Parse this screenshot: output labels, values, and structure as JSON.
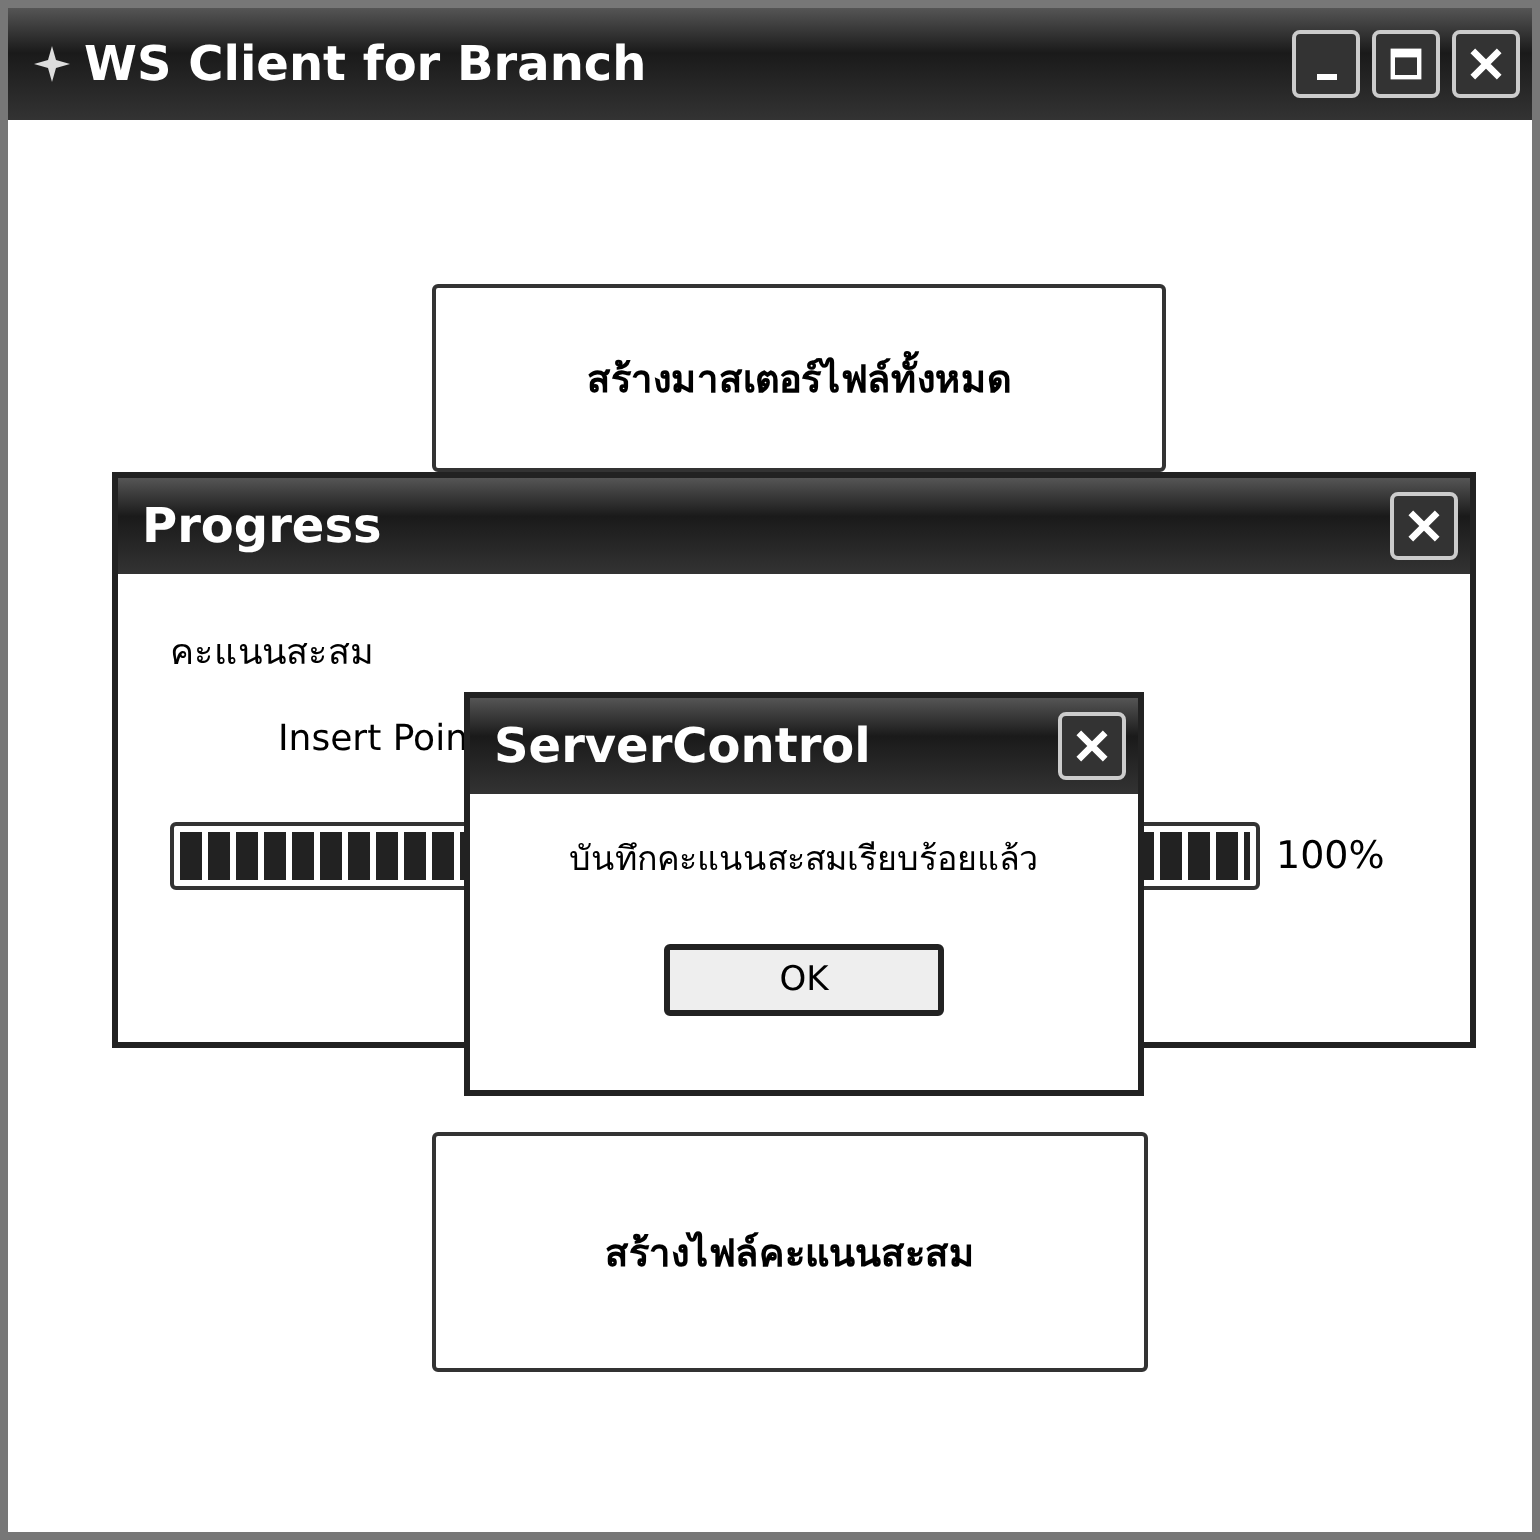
{
  "window": {
    "title": "WS Client for Branch"
  },
  "buttons": [
    {
      "label": "สร้างมาสเตอร์ไฟล์ทั้งหมด"
    },
    {
      "label": "สร้างไฟล์คะแนนสะสม"
    }
  ],
  "progress_window": {
    "title": "Progress",
    "heading": "คะแนนสะสม",
    "status": "Insert Poin",
    "level": 1,
    "percent": "100%"
  },
  "message_box": {
    "title": "ServerControl",
    "message": "บันทึกคะแนนสะสมเรียบร้อยแล้ว",
    "button": "OK"
  }
}
